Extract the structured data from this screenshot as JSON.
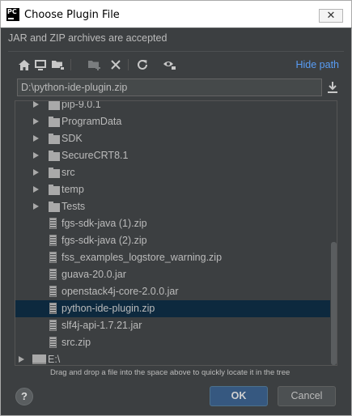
{
  "window": {
    "title": "Choose Plugin File",
    "app_icon_text": "PC",
    "close_glyph": "✕"
  },
  "description": "JAR and ZIP archives are accepted",
  "toolbar": {
    "icons": [
      "home-icon",
      "desktop-icon",
      "project-folder-icon",
      "new-folder-icon",
      "delete-icon",
      "refresh-icon",
      "show-hidden-icon"
    ],
    "hide_path_label": "Hide path"
  },
  "path": {
    "value": "D:\\python-ide-plugin.zip"
  },
  "tree": {
    "items": [
      {
        "label": "pip-9.0.1",
        "type": "folder",
        "expandable": true,
        "selected": false
      },
      {
        "label": "ProgramData",
        "type": "folder",
        "expandable": true,
        "selected": false
      },
      {
        "label": "SDK",
        "type": "folder",
        "expandable": true,
        "selected": false
      },
      {
        "label": "SecureCRT8.1",
        "type": "folder",
        "expandable": true,
        "selected": false
      },
      {
        "label": "src",
        "type": "folder",
        "expandable": true,
        "selected": false
      },
      {
        "label": "temp",
        "type": "folder",
        "expandable": true,
        "selected": false
      },
      {
        "label": "Tests",
        "type": "folder",
        "expandable": true,
        "selected": false
      },
      {
        "label": "fgs-sdk-java (1).zip",
        "type": "archive",
        "expandable": false,
        "selected": false
      },
      {
        "label": "fgs-sdk-java (2).zip",
        "type": "archive",
        "expandable": false,
        "selected": false
      },
      {
        "label": "fss_examples_logstore_warning.zip",
        "type": "archive",
        "expandable": false,
        "selected": false
      },
      {
        "label": "guava-20.0.jar",
        "type": "archive",
        "expandable": false,
        "selected": false
      },
      {
        "label": "openstack4j-core-2.0.0.jar",
        "type": "archive",
        "expandable": false,
        "selected": false
      },
      {
        "label": "python-ide-plugin.zip",
        "type": "archive",
        "expandable": false,
        "selected": true
      },
      {
        "label": "slf4j-api-1.7.21.jar",
        "type": "archive",
        "expandable": false,
        "selected": false
      },
      {
        "label": "src.zip",
        "type": "archive",
        "expandable": false,
        "selected": false
      },
      {
        "label": "E:\\",
        "type": "drive",
        "expandable": true,
        "selected": false
      }
    ]
  },
  "hint": "Drag and drop a file into the space above to quickly locate it in the tree",
  "buttons": {
    "help": "?",
    "ok": "OK",
    "cancel": "Cancel"
  },
  "colors": {
    "background": "#3c3f41",
    "selection": "#0d293e",
    "link": "#589df6",
    "ok_button": "#365880"
  }
}
